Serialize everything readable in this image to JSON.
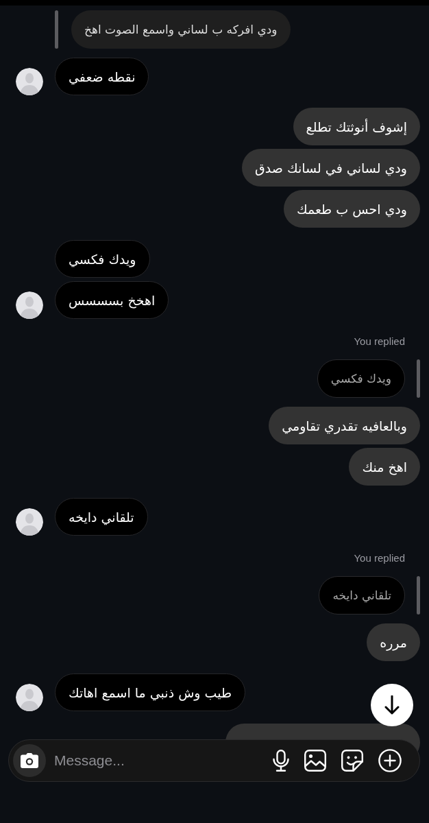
{
  "messages": [
    {
      "kind": "quote",
      "outgoing": false,
      "text": "ودي افركه ب لساني واسمع الصوت اهخ"
    },
    {
      "kind": "message",
      "outgoing": false,
      "text": "نقطه ضعفي",
      "avatar": true
    },
    {
      "kind": "message",
      "outgoing": true,
      "text": "إشوف أنوثتك تطلع"
    },
    {
      "kind": "message",
      "outgoing": true,
      "text": "ودي لساني في لسانك صدق"
    },
    {
      "kind": "message",
      "outgoing": true,
      "text": "ودي احس ب طعمك"
    },
    {
      "kind": "message",
      "outgoing": false,
      "text": "ويدك فكسي",
      "avatar": false
    },
    {
      "kind": "message",
      "outgoing": false,
      "text": "اهخخ بسسسس",
      "avatar": true
    },
    {
      "kind": "label",
      "outgoing": true,
      "text": "You replied"
    },
    {
      "kind": "quote",
      "outgoing": true,
      "text": "ويدك فكسي"
    },
    {
      "kind": "message",
      "outgoing": true,
      "text": "وبالعافيه تقدري تقاومي"
    },
    {
      "kind": "message",
      "outgoing": true,
      "text": "اهخ منك"
    },
    {
      "kind": "message",
      "outgoing": false,
      "text": "تلقاني دايخه",
      "avatar": true
    },
    {
      "kind": "label",
      "outgoing": true,
      "text": "You replied"
    },
    {
      "kind": "quote",
      "outgoing": true,
      "text": "تلقاني دايخه"
    },
    {
      "kind": "message",
      "outgoing": true,
      "text": "مرره"
    },
    {
      "kind": "message",
      "outgoing": false,
      "text": "طيب وش ذنبي ما اسمع اهاتك",
      "avatar": true
    },
    {
      "kind": "message",
      "outgoing": true
    }
  ],
  "composer": {
    "placeholder": "Message..."
  }
}
